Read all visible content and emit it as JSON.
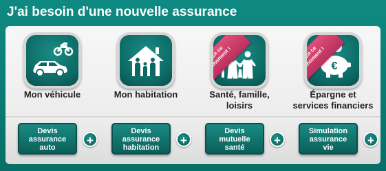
{
  "header": {
    "title": "J'ai besoin d'une nouvelle assurance"
  },
  "categories": [
    {
      "label_line1": "Mon véhicule",
      "label_line2": "",
      "icon": "car-motorbike-icon",
      "button_line1": "Devis",
      "button_line2": "assurance",
      "button_line3": "auto"
    },
    {
      "label_line1": "Mon habitation",
      "label_line2": "",
      "icon": "house-family-icon",
      "button_line1": "Devis",
      "button_line2": "assurance",
      "button_line3": "habitation"
    },
    {
      "label_line1": "Santé, famille,",
      "label_line2": "loisirs",
      "icon": "family-icon",
      "ribbon_line1": "En ce",
      "ribbon_line2": "moment !",
      "button_line1": "Devis",
      "button_line2": "mutuelle",
      "button_line3": "santé"
    },
    {
      "label_line1": "Épargne et",
      "label_line2": "services financiers",
      "icon": "piggy-bank-euro-icon",
      "ribbon_line1": "En ce",
      "ribbon_line2": "moment !",
      "button_line1": "Simulation",
      "button_line2": "assurance",
      "button_line3": "vie"
    }
  ],
  "plus_symbol": "+",
  "colors": {
    "teal": "#0b7b74",
    "ribbon": "#d6426f",
    "card": "#efefef"
  }
}
